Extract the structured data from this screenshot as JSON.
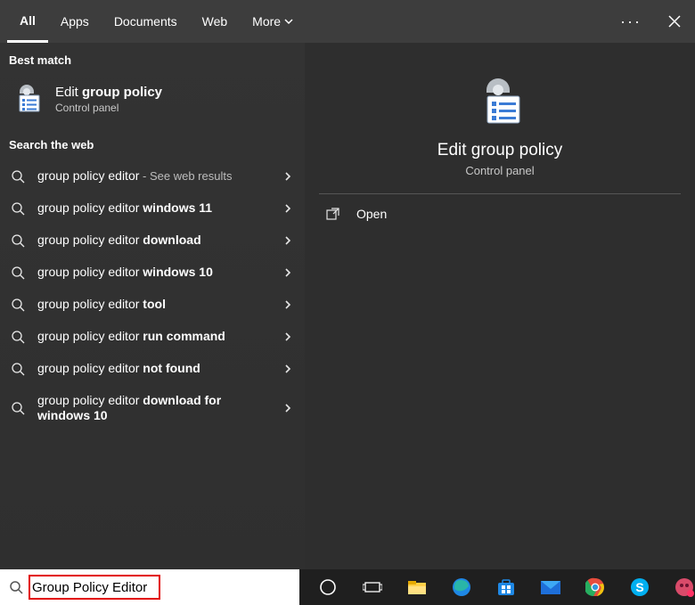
{
  "tabs": {
    "items": [
      "All",
      "Apps",
      "Documents",
      "Web",
      "More"
    ],
    "active_index": 0
  },
  "left": {
    "best_header": "Best match",
    "best": {
      "title_prefix": "Edit ",
      "title_bold": "group policy",
      "subtitle": "Control panel"
    },
    "web_header": "Search the web",
    "suggestions": [
      {
        "prefix": "group policy editor",
        "bold": "",
        "suffix_hint": " - See web results"
      },
      {
        "prefix": "group policy editor ",
        "bold": "windows 11",
        "suffix_hint": ""
      },
      {
        "prefix": "group policy editor ",
        "bold": "download",
        "suffix_hint": ""
      },
      {
        "prefix": "group policy editor ",
        "bold": "windows 10",
        "suffix_hint": ""
      },
      {
        "prefix": "group policy editor ",
        "bold": "tool",
        "suffix_hint": ""
      },
      {
        "prefix": "group policy editor ",
        "bold": "run command",
        "suffix_hint": ""
      },
      {
        "prefix": "group policy editor ",
        "bold": "not found",
        "suffix_hint": ""
      },
      {
        "prefix": "group policy editor ",
        "bold": "download for windows 10",
        "suffix_hint": "",
        "tall": true
      }
    ]
  },
  "right": {
    "preview_title": "Edit group policy",
    "preview_sub": "Control panel",
    "actions": {
      "open": "Open"
    }
  },
  "taskbar": {
    "search_value": "Group Policy Editor"
  }
}
